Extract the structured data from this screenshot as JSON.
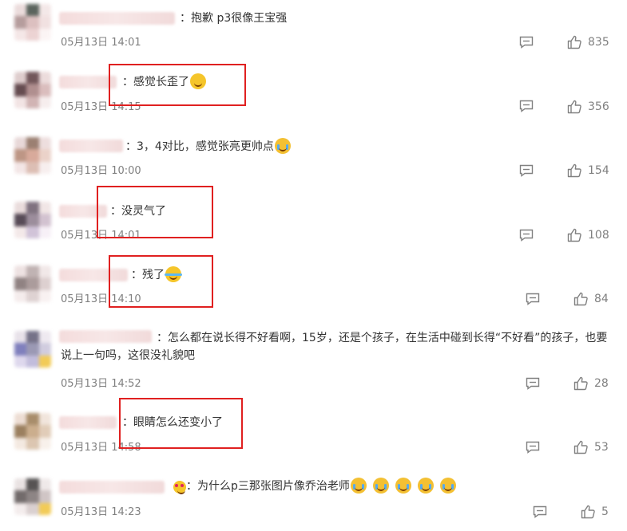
{
  "comments": [
    {
      "text": "：抱歉 p3很像王宝强",
      "date": "05月13日 14:01",
      "likes": "835"
    },
    {
      "text": "：感觉长歪了",
      "date": "05月13日 14:15",
      "likes": "356",
      "emoji": "laugh-emoji"
    },
    {
      "text": "：3，4对比，感觉张亮更帅点",
      "date": "05月13日 10:00",
      "likes": "154",
      "emoji": "cry-laugh-emoji"
    },
    {
      "text": "：没灵气了",
      "date": "05月13日 14:01",
      "likes": "108"
    },
    {
      "text": "：残了",
      "date": "05月13日 14:10",
      "likes": "84",
      "emoji": "crying-emoji"
    },
    {
      "text": "：怎么都在说长得不好看啊，15岁，还是个孩子，在生活中碰到长得“不好看”的孩子，也要说上一句吗，这很没礼貌吧",
      "date": "05月13日 14:52",
      "likes": "28"
    },
    {
      "text": "：眼睛怎么还变小了",
      "date": "05月13日 14:58",
      "likes": "53"
    },
    {
      "text": "：为什么p三那张图片像乔治老师",
      "date": "05月13日 14:23",
      "likes": "5",
      "emoji": "cry-laugh-emoji"
    }
  ],
  "icons": {
    "reply": "comment-icon",
    "like": "thumbs-up-icon"
  },
  "colors": {
    "highlight": "#e02020",
    "meta": "#808080",
    "text": "#333333"
  }
}
